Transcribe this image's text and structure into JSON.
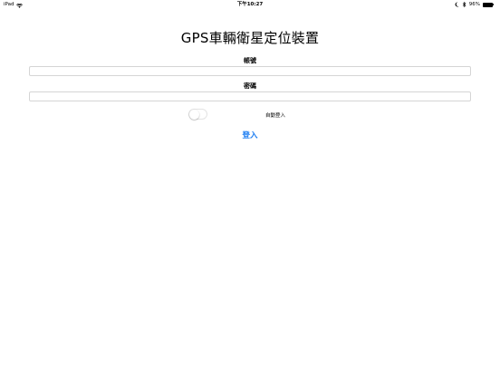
{
  "status_bar": {
    "device": "iPad",
    "time": "下午10:27",
    "battery_text": "96%",
    "battery_level": 0.96,
    "icons": [
      "wifi-icon",
      "moon-icon",
      "bluetooth-icon",
      "battery-icon"
    ]
  },
  "app": {
    "title": "GPS車輛衛星定位裝置"
  },
  "form": {
    "account_label": "帳號",
    "account_value": "",
    "account_placeholder": "",
    "password_label": "密碼",
    "password_value": "",
    "password_placeholder": "",
    "auto_login_label": "自動登入",
    "auto_login_on": false,
    "login_label": "登入"
  },
  "colors": {
    "accent": "#1a7cf2",
    "background": "#ffffff",
    "field_border": "#d5d5d5"
  }
}
